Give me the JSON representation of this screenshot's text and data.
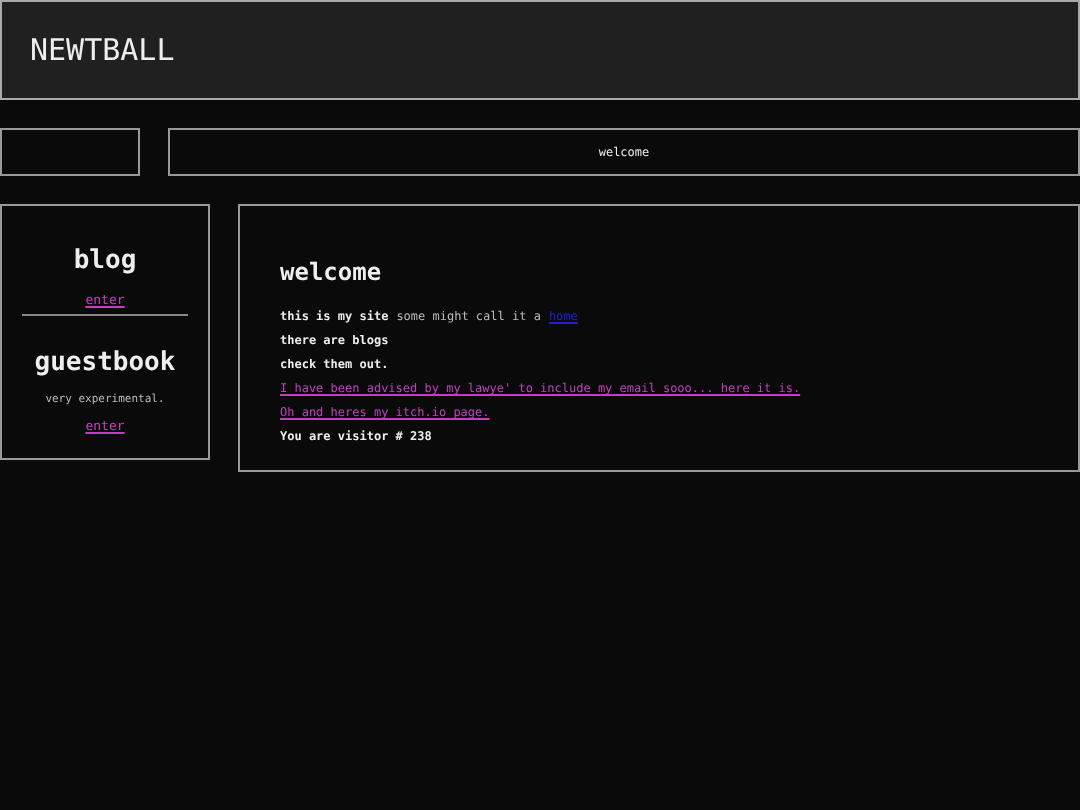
{
  "header": {
    "title": "NEWTBALL"
  },
  "nav": {
    "title": "welcome"
  },
  "sidebar": {
    "sections": [
      {
        "title": "blog",
        "link": "enter"
      },
      {
        "title": "guestbook",
        "note": "very experimental.",
        "link": "enter"
      }
    ]
  },
  "main": {
    "title": "welcome",
    "lines": [
      {
        "kind": "mixed",
        "text": "this is my site",
        "note": "some might call it a",
        "link": "home"
      },
      {
        "kind": "text",
        "text": "there are blogs"
      },
      {
        "kind": "text",
        "text": "check them out."
      },
      {
        "kind": "link",
        "text": "I have been advised by my lawye' to include my email sooo... here it is."
      },
      {
        "kind": "link",
        "text": "Oh and heres my itch.io page."
      },
      {
        "kind": "text",
        "text": "You are visitor # 238"
      }
    ]
  }
}
